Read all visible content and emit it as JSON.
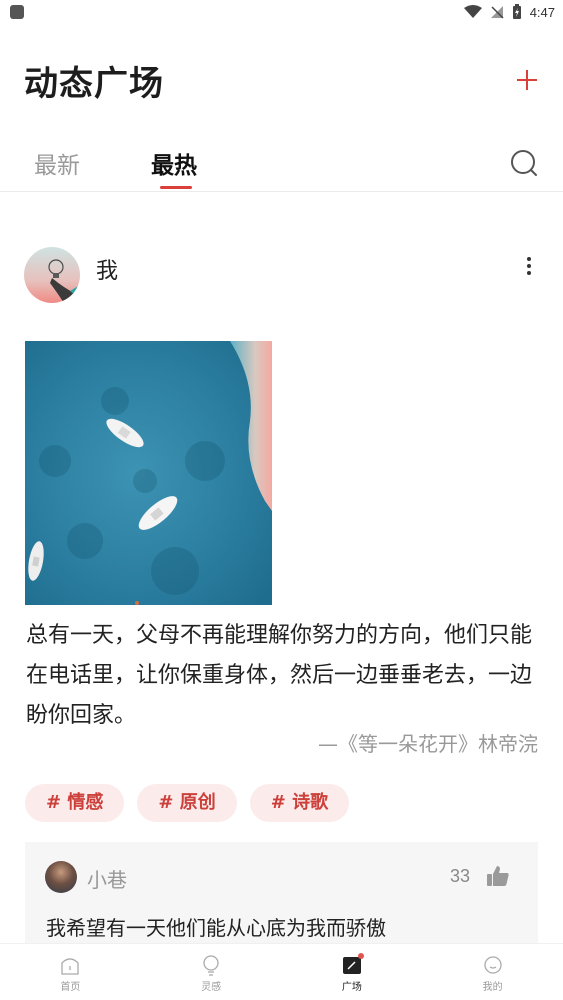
{
  "status_bar": {
    "time": "4:47"
  },
  "header": {
    "title": "动态广场",
    "add_icon": "plus-icon"
  },
  "tabs": [
    {
      "label": "最新",
      "active": false
    },
    {
      "label": "最热",
      "active": true
    }
  ],
  "search_icon": "search-icon",
  "post": {
    "author": "我",
    "text": "总有一天，父母不再能理解你努力的方向，他们只能在电话里，让你保重身体，然后一边垂垂老去，一边盼你回家。",
    "source": "—《等一朵花开》林帝浣",
    "tags": [
      "# 情感",
      "# 原创",
      "# 诗歌"
    ],
    "comment": {
      "author": "小巷",
      "likes": "33",
      "text": "我希望有一天他们能从心底为我而骄傲"
    }
  },
  "bottom_nav": [
    {
      "label": "首页",
      "icon": "home-icon",
      "active": false
    },
    {
      "label": "灵感",
      "icon": "lightbulb-icon",
      "active": false
    },
    {
      "label": "广场",
      "icon": "square-icon",
      "active": true
    },
    {
      "label": "我的",
      "icon": "profile-icon",
      "active": false
    }
  ],
  "colors": {
    "accent": "#d9403a",
    "tag_bg": "#fbeceb",
    "tag_text": "#cc3f3a",
    "comment_bg": "#f6f6f6"
  }
}
